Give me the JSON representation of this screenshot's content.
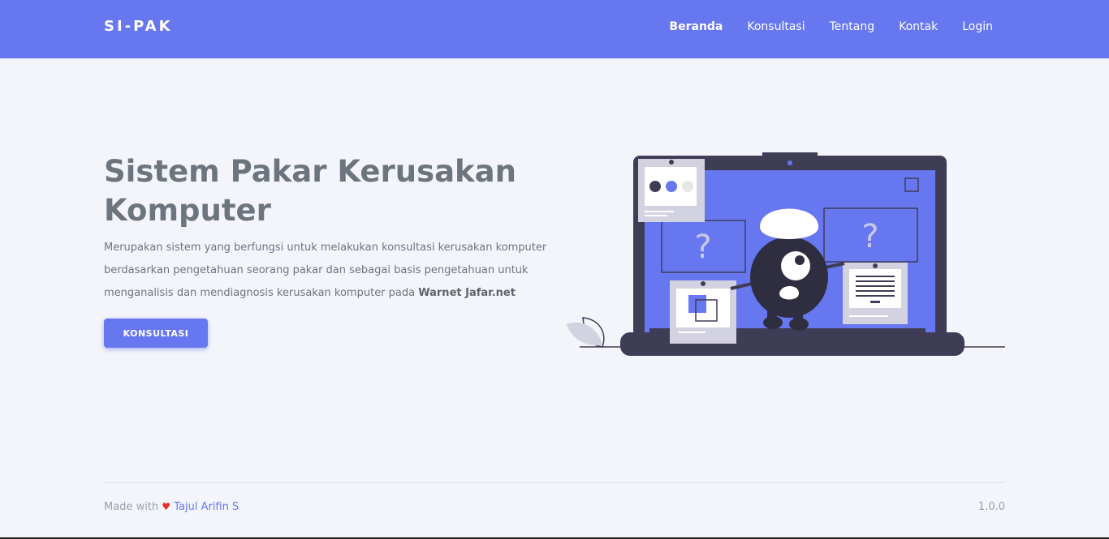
{
  "brand": "SI-PAK",
  "nav": {
    "items": [
      {
        "label": "Beranda",
        "active": true
      },
      {
        "label": "Konsultasi",
        "active": false
      },
      {
        "label": "Tentang",
        "active": false
      },
      {
        "label": "Kontak",
        "active": false
      },
      {
        "label": "Login",
        "active": false
      }
    ]
  },
  "hero": {
    "title": "Sistem Pakar Kerusakan Komputer",
    "description": "Merupakan sistem yang berfungsi untuk melakukan konsultasi kerusakan komputer berdasarkan pengetahuan seorang pakar dan sebagai basis pengetahuan untuk menganalisis dan mendiagnosis kerusakan komputer pada",
    "description_bold": "Warnet Jafar.net",
    "cta_label": "KONSULTASI"
  },
  "footer": {
    "made_with": "Made with",
    "heart_icon": "heart-icon",
    "author": "Tajul Arifin S",
    "version": "1.0.0"
  },
  "colors": {
    "primary": "#6777ef",
    "background": "#f4f5fa",
    "dark": "#3f3d56"
  },
  "illustration": {
    "question_mark": "?"
  }
}
